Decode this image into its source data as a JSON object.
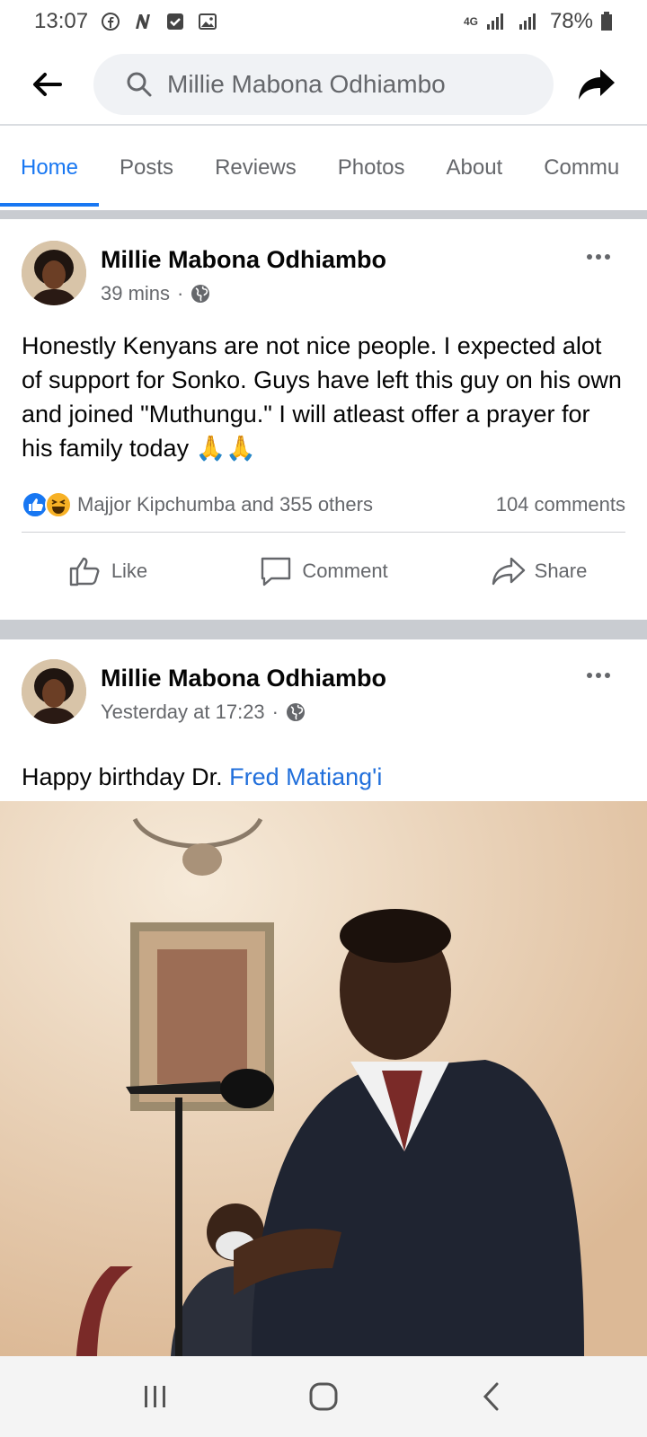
{
  "status_bar": {
    "time": "13:07",
    "battery": "78%",
    "network": "4G"
  },
  "search": {
    "query": "Millie Mabona Odhiambo"
  },
  "tabs": [
    {
      "label": "Home",
      "active": true
    },
    {
      "label": "Posts"
    },
    {
      "label": "Reviews"
    },
    {
      "label": "Photos"
    },
    {
      "label": "About"
    },
    {
      "label": "Commu"
    }
  ],
  "posts": [
    {
      "author": "Millie Mabona Odhiambo",
      "time": "39 mins",
      "text": "Honestly Kenyans are not nice people. I expected alot of support for Sonko. Guys have left this guy on his own and joined \"Muthungu.\" I will atleast offer a prayer for his family today 🙏🙏",
      "reactions_text": "Majjor Kipchumba and 355 others",
      "comments_text": "104 comments",
      "actions": {
        "like": "Like",
        "comment": "Comment",
        "share": "Share"
      }
    },
    {
      "author": "Millie Mabona Odhiambo",
      "time": "Yesterday at 17:23",
      "text_prefix": "Happy birthday Dr. ",
      "text_link": "Fred Matiang'i"
    }
  ],
  "colors": {
    "accent": "#1877f2",
    "link": "#216fdb",
    "secondary_text": "#65676b",
    "separator": "#c9ccd1"
  },
  "icons": [
    "back-arrow-icon",
    "search-icon",
    "share-arrow-icon",
    "globe-icon",
    "more-icon",
    "like-icon",
    "comment-icon",
    "share-icon",
    "recent-apps-icon",
    "home-icon",
    "back-icon"
  ]
}
